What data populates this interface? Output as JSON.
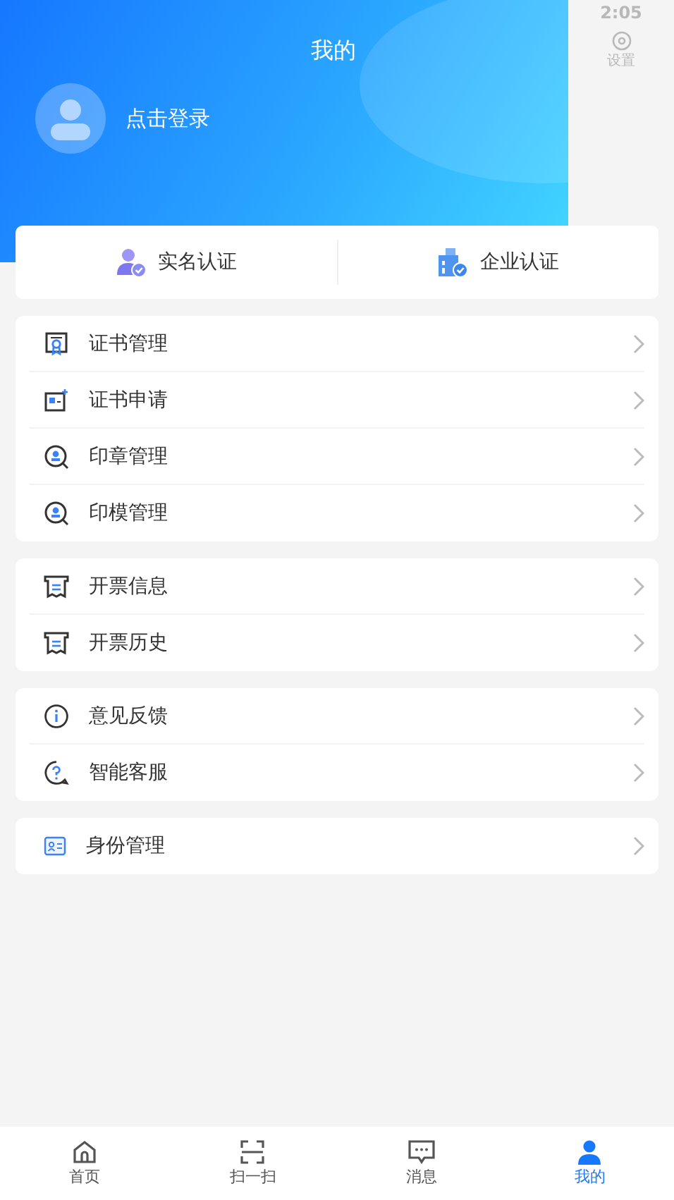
{
  "status_bar": {
    "time": "2:05"
  },
  "header": {
    "title": "我的",
    "login": "点击登录",
    "settings_label": "设置"
  },
  "verify": [
    {
      "kind": "person",
      "label": "实名认证"
    },
    {
      "kind": "company",
      "label": "企业认证"
    }
  ],
  "groups": [
    {
      "items": [
        {
          "kind": "certificate",
          "label": "证书管理"
        },
        {
          "kind": "cert-apply",
          "label": "证书申请"
        },
        {
          "kind": "seal",
          "label": "印章管理"
        },
        {
          "kind": "seal",
          "label": "印模管理"
        }
      ]
    },
    {
      "items": [
        {
          "kind": "invoice",
          "label": "开票信息"
        },
        {
          "kind": "invoice",
          "label": "开票历史"
        }
      ]
    },
    {
      "items": [
        {
          "kind": "info",
          "label": "意见反馈"
        },
        {
          "kind": "help",
          "label": "智能客服"
        }
      ]
    },
    {
      "items": [
        {
          "kind": "id",
          "label": "身份管理"
        }
      ]
    }
  ],
  "tabs": [
    {
      "kind": "home",
      "label": "首页",
      "selected": false
    },
    {
      "kind": "scan",
      "label": "扫一扫",
      "selected": false
    },
    {
      "kind": "message",
      "label": "消息",
      "selected": false
    },
    {
      "kind": "me",
      "label": "我的",
      "selected": true
    }
  ]
}
